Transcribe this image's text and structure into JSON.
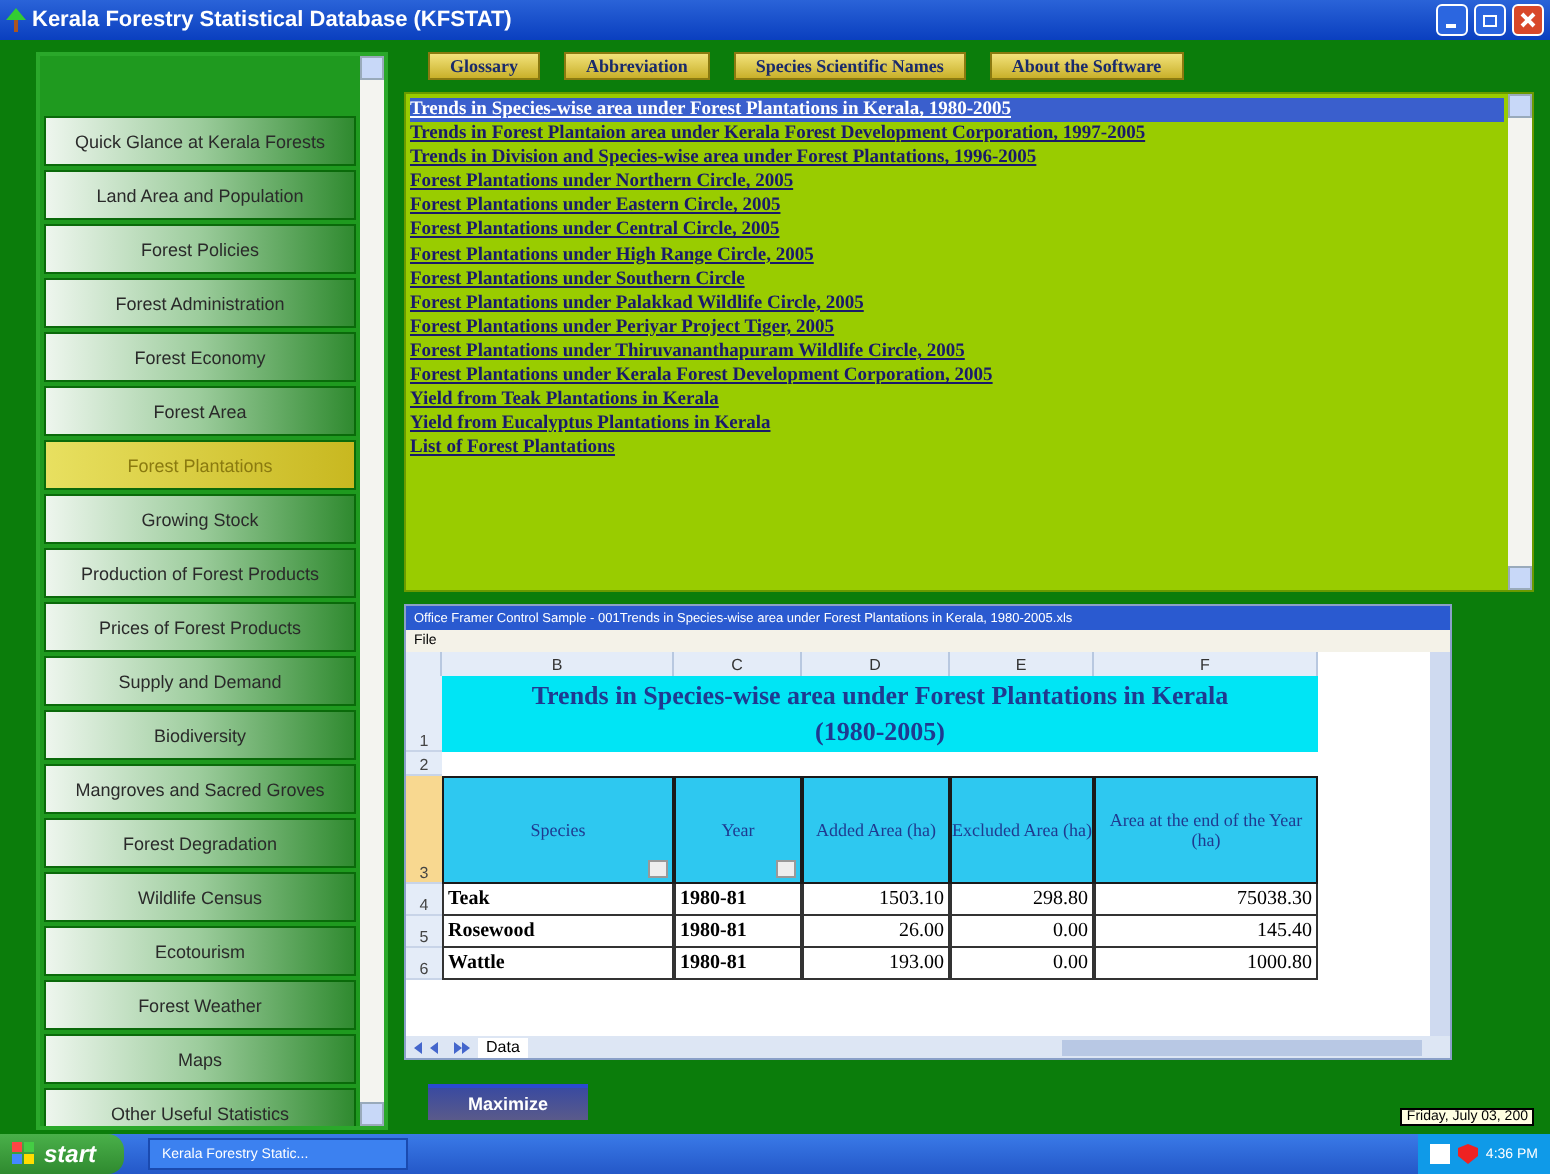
{
  "window": {
    "title": "Kerala Forestry Statistical Database (KFSTAT)"
  },
  "top_buttons": [
    "Glossary",
    "Abbreviation",
    "Species Scientific Names",
    "About the Software"
  ],
  "sidebar": {
    "items": [
      {
        "label": "Quick Glance at Kerala Forests",
        "selected": false
      },
      {
        "label": "Land Area and  Population",
        "selected": false
      },
      {
        "label": "Forest Policies",
        "selected": false
      },
      {
        "label": "Forest Administration",
        "selected": false
      },
      {
        "label": "Forest Economy",
        "selected": false
      },
      {
        "label": "Forest Area",
        "selected": false
      },
      {
        "label": "Forest Plantations",
        "selected": true
      },
      {
        "label": "Growing Stock",
        "selected": false
      },
      {
        "label": "Production of Forest Products",
        "selected": false
      },
      {
        "label": "Prices of Forest Products",
        "selected": false
      },
      {
        "label": "Supply and Demand",
        "selected": false
      },
      {
        "label": "Biodiversity",
        "selected": false
      },
      {
        "label": "Mangroves and Sacred Groves",
        "selected": false
      },
      {
        "label": "Forest Degradation",
        "selected": false
      },
      {
        "label": "Wildlife Census",
        "selected": false
      },
      {
        "label": "Ecotourism",
        "selected": false
      },
      {
        "label": "Forest Weather",
        "selected": false
      },
      {
        "label": "Maps",
        "selected": false
      },
      {
        "label": "Other Useful Statistics",
        "selected": false
      }
    ]
  },
  "links": [
    {
      "label": "Trends in Species-wise area under Forest Plantations in Kerala, 1980-2005",
      "selected": true
    },
    {
      "label": "Trends in Forest Plantaion area under Kerala Forest Development Corporation, 1997-2005",
      "selected": false
    },
    {
      "label": "Trends in Division and Species-wise area under Forest Plantations, 1996-2005",
      "selected": false
    },
    {
      "label": "Forest Plantations under Northern Circle, 2005",
      "selected": false
    },
    {
      "label": "Forest Plantations under Eastern Circle, 2005",
      "selected": false
    },
    {
      "label": "Forest Plantations under Central Circle, 2005",
      "selected": false
    },
    {
      "label": "Forest Plantations under High Range Circle, 2005",
      "selected": false
    },
    {
      "label": "Forest Plantations under Southern Circle",
      "selected": false
    },
    {
      "label": "Forest Plantations under Palakkad Wildlife Circle, 2005",
      "selected": false
    },
    {
      "label": "Forest Plantations under Periyar Project Tiger, 2005",
      "selected": false
    },
    {
      "label": "Forest Plantations under Thiruvananthapuram Wildlife Circle, 2005",
      "selected": false
    },
    {
      "label": "Forest Plantations under Kerala Forest Development Corporation, 2005",
      "selected": false
    },
    {
      "label": "Yield from Teak Plantations in Kerala",
      "selected": false
    },
    {
      "label": "Yield from Eucalyptus Plantations in Kerala",
      "selected": false
    },
    {
      "label": "List of Forest Plantations",
      "selected": false
    }
  ],
  "spreadsheet": {
    "title": "Office Framer Control Sample - 001Trends in Species-wise area under Forest Plantations in Kerala, 1980-2005.xls",
    "menu": [
      "File"
    ],
    "columns": [
      "B",
      "C",
      "D",
      "E",
      "F"
    ],
    "sheet_title": "Trends in Species-wise area under Forest Plantations in Kerala (1980-2005)",
    "headers": [
      "Species",
      "Year",
      "Added Area (ha)",
      "Excluded Area (ha)",
      "Area at the end of the Year (ha)"
    ],
    "row_numbers": [
      "1",
      "2",
      "3"
    ],
    "rows": [
      {
        "num": "4",
        "cells": [
          "Teak",
          "1980-81",
          "1503.10",
          "298.80",
          "75038.30"
        ]
      },
      {
        "num": "5",
        "cells": [
          "Rosewood",
          "1980-81",
          "26.00",
          "0.00",
          "145.40"
        ]
      },
      {
        "num": "6",
        "cells": [
          "Wattle",
          "1980-81",
          "193.00",
          "0.00",
          "1000.80"
        ]
      }
    ],
    "sheet_tabs": [
      {
        "label": "Data",
        "selected": true
      }
    ]
  },
  "maximize_button": "Maximize",
  "tooltip": "Friday, July 03, 200",
  "taskbar": {
    "start": "start",
    "task": "Kerala Forestry Static...",
    "clock": "4:36 PM"
  }
}
